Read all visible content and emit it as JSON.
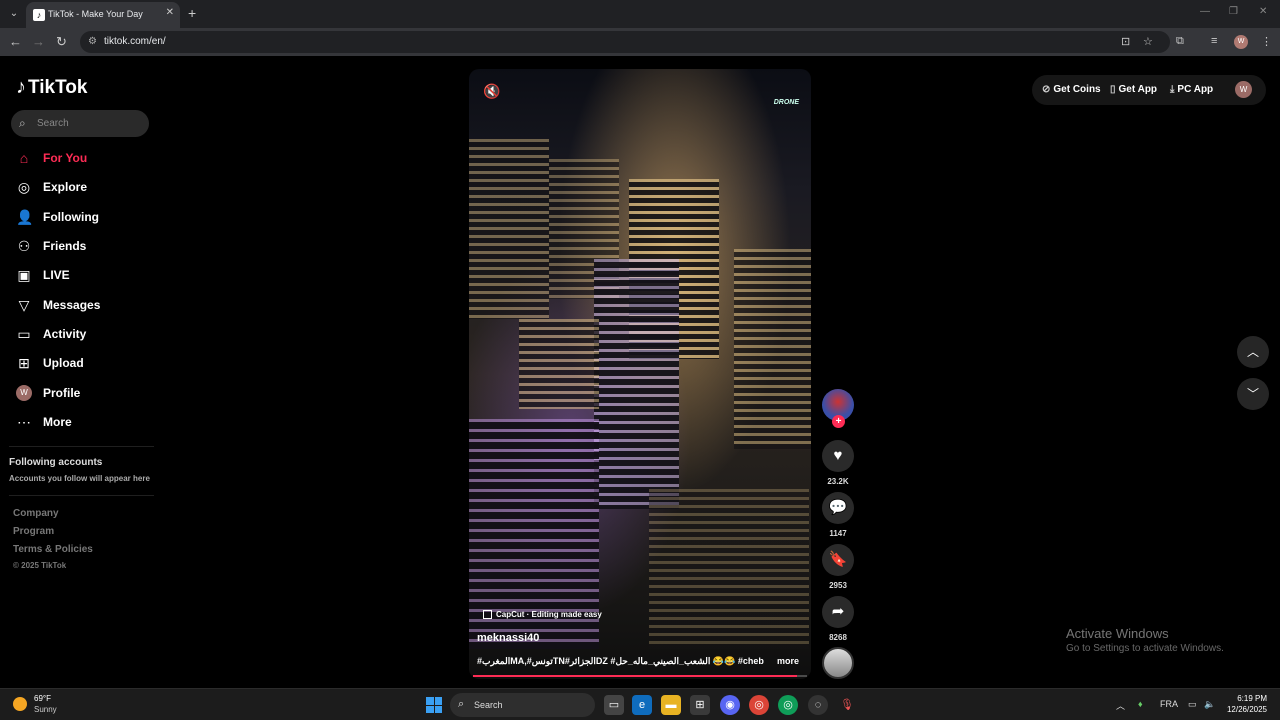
{
  "browser": {
    "tab_title": "TikTok - Make Your Day",
    "url": "tiktok.com/en/",
    "profile_initial": "W"
  },
  "sidebar": {
    "logo": "TikTok",
    "search_placeholder": "Search",
    "items": [
      {
        "label": "For You",
        "icon": "home-icon",
        "active": true
      },
      {
        "label": "Explore",
        "icon": "compass-icon"
      },
      {
        "label": "Following",
        "icon": "user-follow-icon"
      },
      {
        "label": "Friends",
        "icon": "friends-icon"
      },
      {
        "label": "LIVE",
        "icon": "live-icon"
      },
      {
        "label": "Messages",
        "icon": "send-icon"
      },
      {
        "label": "Activity",
        "icon": "activity-icon"
      },
      {
        "label": "Upload",
        "icon": "upload-icon"
      },
      {
        "label": "Profile",
        "icon": "avatar"
      },
      {
        "label": "More",
        "icon": "more-icon"
      }
    ],
    "profile_initial": "W",
    "following_title": "Following accounts",
    "following_sub": "Accounts you follow will appear here",
    "footer_links": [
      "Company",
      "Program",
      "Terms & Policies"
    ],
    "copyright": "© 2025 TikTok"
  },
  "video": {
    "watermark": "DRONE",
    "capcut": "CapCut · Editing made easy",
    "author": "meknassi40",
    "caption": "#المغربMA,#تونسTN#الجزائرDZ #الشعب_الصيني_ماله_حل 😂😂 #cheb",
    "more": "more",
    "progress": 0.97
  },
  "actions": {
    "likes": "23.2K",
    "comments": "1147",
    "saves": "2953",
    "shares": "8268"
  },
  "top_right": {
    "get_coins": "Get Coins",
    "get_app": "Get App",
    "pc_app": "PC App",
    "avatar_initial": "W"
  },
  "activation": {
    "title": "Activate Windows",
    "sub": "Go to Settings to activate Windows."
  },
  "taskbar": {
    "temp": "69°F",
    "condition": "Sunny",
    "search": "Search",
    "lang": "FRA",
    "time": "6:19 PM",
    "date": "12/26/2025"
  },
  "colors": {
    "accent": "#fe2c55",
    "background": "#000000"
  }
}
